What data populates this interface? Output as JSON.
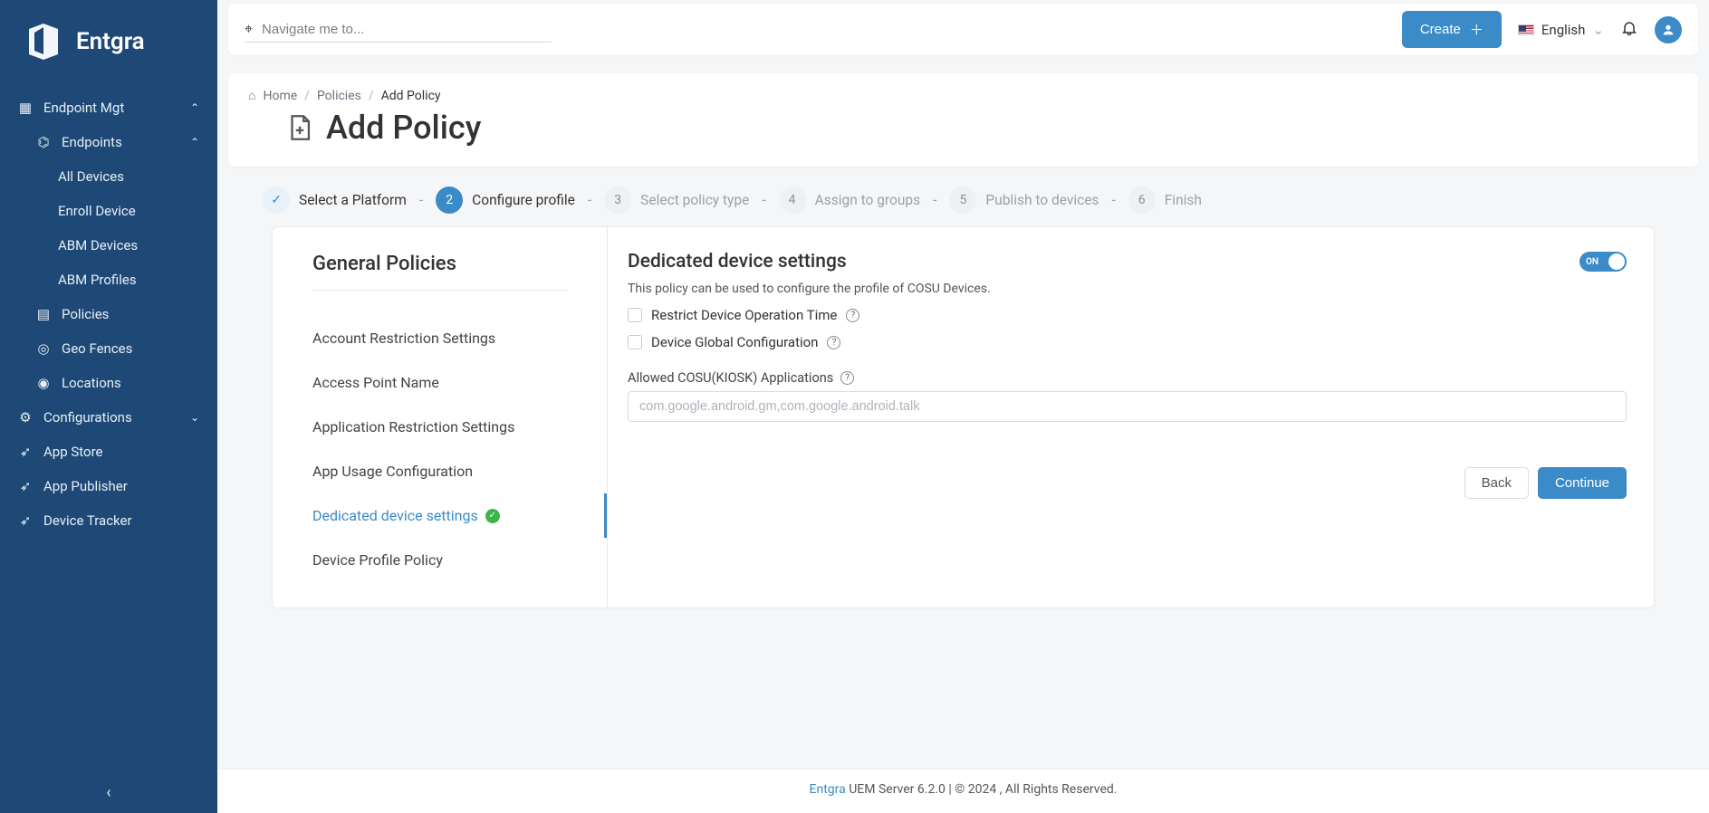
{
  "brand": "Entgra",
  "topbar": {
    "navigate_placeholder": "Navigate me to...",
    "create_label": "Create",
    "language": "English"
  },
  "sidebar": {
    "endpoint_mgt": "Endpoint Mgt",
    "endpoints": "Endpoints",
    "endpoints_children": {
      "all_devices": "All Devices",
      "enroll_device": "Enroll Device",
      "abm_devices": "ABM Devices",
      "abm_profiles": "ABM Profiles"
    },
    "policies": "Policies",
    "geo_fences": "Geo Fences",
    "locations": "Locations",
    "configurations": "Configurations",
    "app_store": "App Store",
    "app_publisher": "App Publisher",
    "device_tracker": "Device Tracker"
  },
  "breadcrumb": {
    "home": "Home",
    "policies": "Policies",
    "current": "Add Policy"
  },
  "page_title": "Add Policy",
  "steps": {
    "s1": "Select a Platform",
    "s2": "Configure profile",
    "s3": "Select policy type",
    "s4": "Assign to groups",
    "s5": "Publish to devices",
    "s6": "Finish"
  },
  "policy_list": {
    "heading": "General Policies",
    "items": {
      "account_restriction": "Account Restriction Settings",
      "access_point": "Access Point Name",
      "app_restriction": "Application Restriction Settings",
      "app_usage": "App Usage Configuration",
      "dedicated_device": "Dedicated device settings",
      "device_profile": "Device Profile Policy"
    }
  },
  "form": {
    "title": "Dedicated device settings",
    "toggle_label": "ON",
    "description": "This policy can be used to configure the profile of COSU Devices.",
    "restrict_time": "Restrict Device Operation Time",
    "global_config": "Device Global Configuration",
    "allowed_apps_label": "Allowed COSU(KIOSK) Applications",
    "allowed_apps_placeholder": "com.google.android.gm,com.google.android.talk",
    "back": "Back",
    "continue": "Continue"
  },
  "footer": {
    "brand": "Entgra",
    "rest": " UEM Server 6.2.0 | © 2024 , All Rights Reserved."
  }
}
